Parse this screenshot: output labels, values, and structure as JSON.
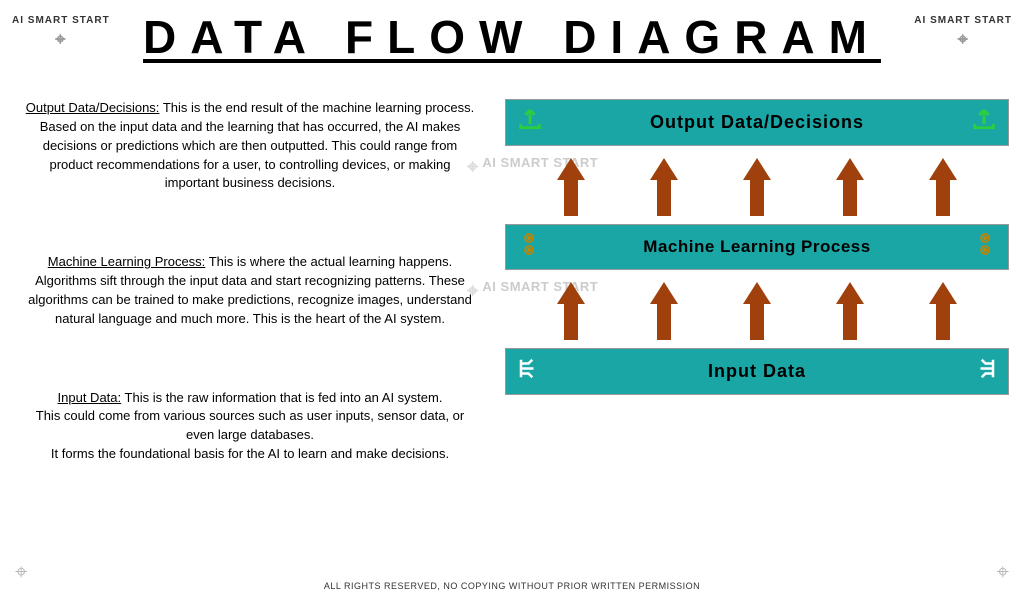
{
  "brand": "AI SMART START",
  "title": "DATA FLOW DIAGRAM",
  "sections": {
    "output": {
      "label": "Output Data/Decisions:",
      "text": "This is the end result of the machine learning process. Based on the input data and the learning that has occurred, the AI makes decisions or predictions which are then outputted. This could range from product recommendations for a user, to controlling devices, or making important business decisions.",
      "box_label": "Output Data/Decisions"
    },
    "ml": {
      "label": "Machine Learning Process:",
      "text": "This is where the actual learning happens. Algorithms sift through the input data and start recognizing patterns. These algorithms can be trained to make predictions, recognize images, understand natural language and much more. This is the heart of the AI system.",
      "box_label": "Machine Learning Process"
    },
    "input": {
      "label": "Input Data:",
      "text_line1": "This is the raw information that is fed into an AI system.",
      "text_line2": "This could come from various sources such as user inputs, sensor data, or even large databases.",
      "text_line3": "It forms the foundational basis for the AI to learn and make decisions.",
      "box_label": "Input Data"
    }
  },
  "footer": "ALL RIGHTS RESERVED, NO COPYING WITHOUT PRIOR WRITTEN PERMISSION",
  "watermark": "AI SMART START"
}
